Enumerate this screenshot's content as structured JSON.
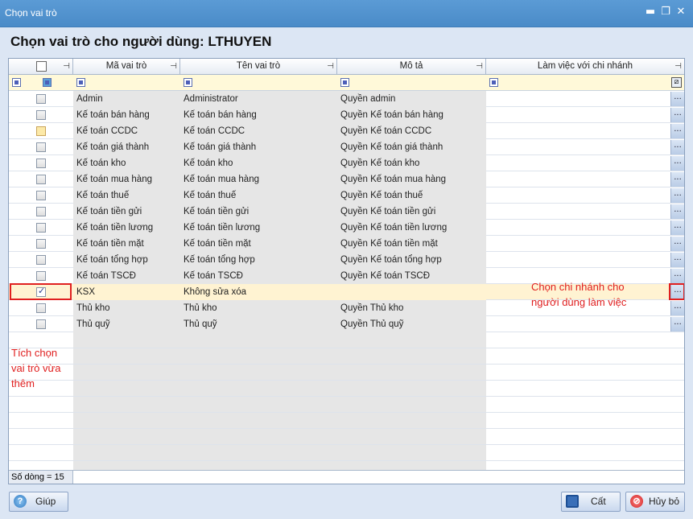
{
  "window": {
    "title": "Chọn vai trò",
    "controls": [
      "▬",
      "❐",
      "✕"
    ]
  },
  "heading": "Chọn vai trò cho người dùng: LTHUYEN",
  "grid": {
    "headers": [
      "Mã vai trò",
      "Tên vai trò",
      "Mô tả",
      "Làm việc với chi nhánh"
    ],
    "rows": [
      {
        "code": "Admin",
        "name": "Administrator",
        "desc": "Quyền admin",
        "checked": false
      },
      {
        "code": "Kế toán bán hàng",
        "name": "Kế toán bán hàng",
        "desc": "Quyền Kế toán bán hàng",
        "checked": false
      },
      {
        "code": "Kế toán CCDC",
        "name": "Kế toán CCDC",
        "desc": "Quyền Kế toán CCDC",
        "checked": false
      },
      {
        "code": "Kế toán giá thành",
        "name": "Kế toán giá thành",
        "desc": "Quyền Kế toán giá thành",
        "checked": false
      },
      {
        "code": "Kế toán kho",
        "name": "Kế toán kho",
        "desc": "Quyền Kế toán kho",
        "checked": false
      },
      {
        "code": "Kế toán mua hàng",
        "name": "Kế toán mua hàng",
        "desc": "Quyền Kế toán mua hàng",
        "checked": false
      },
      {
        "code": "Kế toán thuế",
        "name": "Kế toán thuế",
        "desc": "Quyền Kế toán thuế",
        "checked": false
      },
      {
        "code": "Kế toán tiền gửi",
        "name": "Kế toán tiền gửi",
        "desc": "Quyền Kế toán tiền gửi",
        "checked": false
      },
      {
        "code": "Kế toán tiền lương",
        "name": "Kế toán tiền lương",
        "desc": "Quyền Kế toán tiền lương",
        "checked": false
      },
      {
        "code": "Kế toán tiền mặt",
        "name": "Kế toán tiền mặt",
        "desc": "Quyền Kế toán tiền mặt",
        "checked": false
      },
      {
        "code": "Kế toán tổng hợp",
        "name": "Kế toán tổng hợp",
        "desc": "Quyền Kế toán tổng hợp",
        "checked": false
      },
      {
        "code": "Kế toán TSCĐ",
        "name": "Kế toán TSCĐ",
        "desc": "Quyền Kế toán TSCĐ",
        "checked": false
      },
      {
        "code": "KSX",
        "name": "Không sửa xóa",
        "desc": "",
        "checked": true
      },
      {
        "code": "Thủ kho",
        "name": "Thủ kho",
        "desc": "Quyền Thủ kho",
        "checked": false
      },
      {
        "code": "Thủ quỹ",
        "name": "Thủ quỹ",
        "desc": "Quyền Thủ quỹ",
        "checked": false
      }
    ],
    "row_count_label": "Số dòng = 15",
    "ellipsis": "..."
  },
  "annotations": {
    "left": "Tích chọn\nvai trò vừa\nthêm",
    "right": "Chọn chi nhánh cho\nngười dùng làm việc"
  },
  "buttons": {
    "help": "Giúp",
    "save": "Cất",
    "cancel": "Hủy bỏ"
  },
  "colors": {
    "titlebar": "#4a8bc8",
    "annotation": "#e02020",
    "selected_row": "#fff3d2"
  }
}
